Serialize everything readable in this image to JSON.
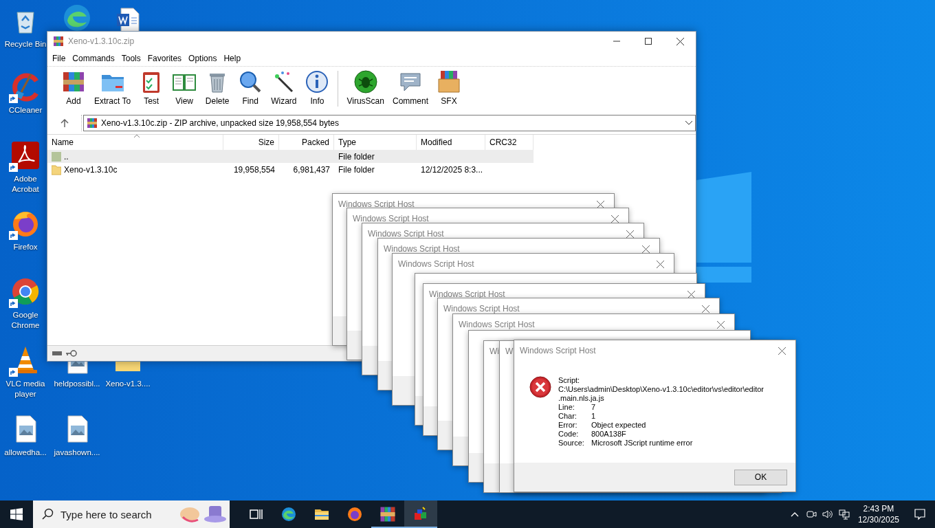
{
  "desktop": {
    "icons": [
      {
        "kind": "recycle",
        "label": "Recycle Bin",
        "shortcut": false
      },
      {
        "kind": "edge",
        "shortcut": false
      },
      {
        "kind": "word",
        "shortcut": false
      },
      {
        "kind": "ccleaner",
        "label": "CCleaner",
        "shortcut": true
      },
      {
        "kind": "acrobat",
        "label": "Adobe Acrobat",
        "shortcut": true
      },
      {
        "kind": "firefox",
        "label": "Firefox",
        "shortcut": true
      },
      {
        "kind": "chrome",
        "label": "Google Chrome",
        "shortcut": true
      },
      {
        "kind": "vlc",
        "label": "VLC media player",
        "shortcut": true
      },
      {
        "kind": "image",
        "label": "heldpossibl...",
        "shortcut": false
      },
      {
        "kind": "folder",
        "label": "Xeno-v1.3....",
        "shortcut": false
      },
      {
        "kind": "image",
        "label": "allowedha...",
        "shortcut": false
      },
      {
        "kind": "image",
        "label": "javashown....",
        "shortcut": false
      }
    ]
  },
  "winrar": {
    "title": "Xeno-v1.3.10c.zip",
    "menu": [
      "File",
      "Commands",
      "Tools",
      "Favorites",
      "Options",
      "Help"
    ],
    "toolbar_groups": [
      {
        "buttons": [
          {
            "kind": "add",
            "label": "Add"
          },
          {
            "kind": "extract",
            "label": "Extract To"
          },
          {
            "kind": "test",
            "label": "Test"
          },
          {
            "kind": "view",
            "label": "View"
          },
          {
            "kind": "delete",
            "label": "Delete"
          },
          {
            "kind": "find",
            "label": "Find"
          },
          {
            "kind": "wizard",
            "label": "Wizard"
          },
          {
            "kind": "info",
            "label": "Info"
          }
        ]
      },
      {
        "buttons": [
          {
            "kind": "virusscan",
            "label": "VirusScan"
          },
          {
            "kind": "comment",
            "label": "Comment"
          },
          {
            "kind": "sfx",
            "label": "SFX"
          }
        ]
      }
    ],
    "address": "Xeno-v1.3.10c.zip - ZIP archive, unpacked size 19,958,554 bytes",
    "columns": [
      "Name",
      "Size",
      "Packed",
      "Type",
      "Modified",
      "CRC32"
    ],
    "rows": [
      {
        "kind": "parent",
        "selected": true,
        "cells": [
          "..",
          "",
          "",
          "File folder",
          "",
          ""
        ]
      },
      {
        "kind": "folder",
        "selected": false,
        "cells": [
          "Xeno-v1.3.10c",
          "19,958,554",
          "6,981,437",
          "File folder",
          "12/12/2025 8:3...",
          ""
        ]
      }
    ]
  },
  "background_dialogs": [
    {
      "kind": "titled",
      "title": "Windows Script Host"
    },
    {
      "kind": "titled",
      "title": "Windows Script Host"
    },
    {
      "kind": "titled",
      "title": "Windows Script Host"
    },
    {
      "kind": "titled",
      "title": "Windows Script Host"
    },
    {
      "kind": "titled",
      "title": "Windows Script Host"
    },
    {
      "kind": "covered"
    },
    {
      "kind": "titled",
      "title": "Windows Script Host"
    },
    {
      "kind": "titled",
      "title": "Windows Script Host"
    },
    {
      "kind": "titled",
      "title": "Windows Script Host"
    },
    {
      "kind": "covered"
    },
    {
      "kind": "stub",
      "title": "Wi"
    },
    {
      "kind": "stub",
      "title": "Wi"
    }
  ],
  "error_dialog": {
    "title": "Windows Script Host",
    "script_label": "Script:",
    "script_path": [
      "C:\\Users\\admin\\Desktop\\Xeno-v1.3.10c\\editor\\vs\\editor\\editor",
      ".main.nls.ja.js"
    ],
    "fields": [
      {
        "label": "Line:",
        "value": "7"
      },
      {
        "label": "Char:",
        "value": "1"
      },
      {
        "label": "Error:",
        "value": "Object expected"
      },
      {
        "label": "Code:",
        "value": "800A138F"
      },
      {
        "label": "Source:",
        "value": "Microsoft JScript runtime error"
      }
    ],
    "button": "OK"
  },
  "taskbar": {
    "search_placeholder": "Type here to search",
    "apps": [
      {
        "kind": "taskview",
        "running": false,
        "selected": false
      },
      {
        "kind": "edge",
        "running": false,
        "selected": false
      },
      {
        "kind": "explorer",
        "running": false,
        "selected": false
      },
      {
        "kind": "firefox",
        "running": false,
        "selected": false
      },
      {
        "kind": "winrar",
        "running": true,
        "selected": false
      },
      {
        "kind": "cubes",
        "running": true,
        "selected": true
      }
    ],
    "time": "2:43 PM",
    "date": "12/30/2025"
  }
}
